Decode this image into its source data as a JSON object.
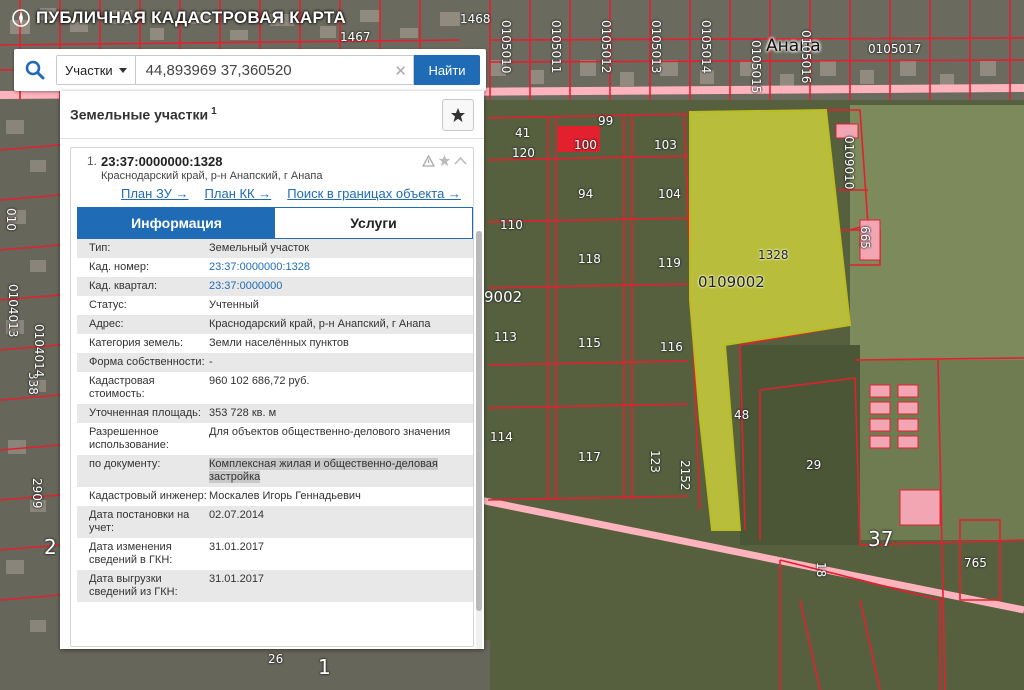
{
  "app": {
    "title": "ПУБЛИЧНАЯ КАДАСТРОВАЯ КАРТА"
  },
  "search": {
    "type_label": "Участки",
    "query": "44,893969 37,360520",
    "button": "Найти"
  },
  "panel": {
    "title": "Земельные участки",
    "count": "1",
    "result": {
      "index": "1.",
      "cad_number": "23:37:0000000:1328",
      "address": "Краснодарский край, р-н Анапский, г Анапа",
      "links": [
        "План ЗУ →",
        "План КК →",
        "Поиск в границах объекта →"
      ],
      "tabs": {
        "info": "Информация",
        "services": "Услуги"
      },
      "info_rows": [
        {
          "key": "Тип:",
          "value": "Земельный участок"
        },
        {
          "key": "Кад. номер:",
          "value": "23:37:0000000:1328",
          "link": true
        },
        {
          "key": "Кад. квартал:",
          "value": "23:37:0000000",
          "link": true
        },
        {
          "key": "Статус:",
          "value": "Учтенный"
        },
        {
          "key": "Адрес:",
          "value": "Краснодарский край, р-н Анапский, г Анапа"
        },
        {
          "key": "Категория земель:",
          "value": "Земли населённых пунктов"
        },
        {
          "key": "Форма собственности:",
          "value": "-"
        },
        {
          "key": "Кадастровая стоимость:",
          "value": "960 102 686,72 руб."
        },
        {
          "key": "Уточненная площадь:",
          "value": "353 728 кв. м"
        },
        {
          "key": "Разрешенное использование:",
          "value": "Для объектов общественно-делового значения"
        },
        {
          "key": "по документу:",
          "value": "Комплексная жилая и общественно-деловая застройка",
          "highlight": true
        },
        {
          "key": "Кадастровый инженер:",
          "value": "Москалев Игорь Геннадьевич"
        },
        {
          "key": "Дата постановки на учет:",
          "value": "02.07.2014"
        },
        {
          "key": "Дата изменения сведений в ГКН:",
          "value": "31.01.2017"
        },
        {
          "key": "Дата выгрузки сведений из ГКН:",
          "value": "31.01.2017"
        }
      ]
    }
  },
  "map": {
    "city": "Анапа",
    "labels": {
      "l1467": "1467",
      "l1468": "1468",
      "l0105010": "0105010",
      "l0105011": "0105011",
      "l0105012": "0105012",
      "l0105013": "0105013",
      "l0105014": "0105014",
      "l0105015": "0105015",
      "l0105016": "0105016",
      "l0105017": "0105017",
      "l41": "41",
      "l120": "120",
      "l100": "100",
      "l99": "99",
      "l103": "103",
      "l94": "94",
      "l104": "104",
      "l110": "110",
      "l118": "118",
      "l119": "119",
      "l1328": "1328",
      "l0109002": "0109002",
      "l9002": "9002",
      "l113": "113",
      "l115": "115",
      "l116": "116",
      "l114": "114",
      "l117": "117",
      "l123": "123",
      "l2152": "2152",
      "l48": "48",
      "l29": "29",
      "l37": "37",
      "l765": "765",
      "l18": "18",
      "l665": "665",
      "l0109010": "0109010",
      "l338": "338",
      "l2909": "2909",
      "l010": "010",
      "l0104013": "0104013",
      "l0104014": "0104014",
      "l26": "26",
      "l1": "1",
      "l2": "2"
    }
  }
}
